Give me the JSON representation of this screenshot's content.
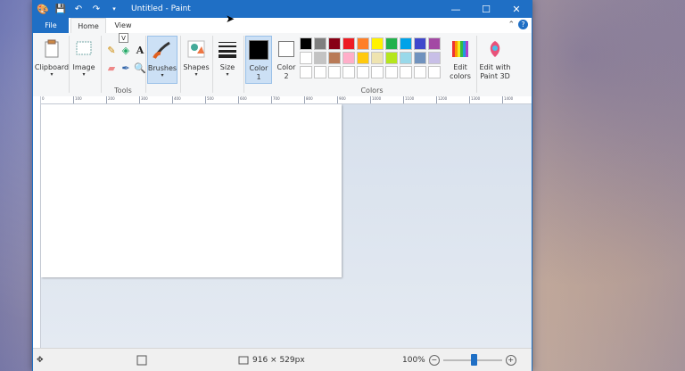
{
  "window": {
    "title": "Untitled - Paint"
  },
  "titlebar_buttons": {
    "minimize": "—",
    "maximize": "☐",
    "close": "✕"
  },
  "tabs": {
    "file": "File",
    "home": "Home",
    "view": "View"
  },
  "keytip": "V",
  "ribbon": {
    "clipboard": {
      "label": "Clipboard"
    },
    "image": {
      "label": "Image"
    },
    "tools_group": {
      "label": "Tools"
    },
    "brushes": {
      "label": "Brushes"
    },
    "shapes": {
      "label": "Shapes"
    },
    "size": {
      "label": "Size"
    },
    "color1": {
      "label": "Color",
      "sub": "1"
    },
    "color2": {
      "label": "Color",
      "sub": "2"
    },
    "colors_group": {
      "label": "Colors"
    },
    "edit_colors": {
      "label": "Edit",
      "sub": "colors"
    },
    "paint3d": {
      "label": "Edit with",
      "sub": "Paint 3D"
    },
    "text_tool_glyph": "A"
  },
  "palette": [
    "#000000",
    "#7f7f7f",
    "#880015",
    "#ed1c24",
    "#ff7f27",
    "#fff200",
    "#22b14c",
    "#00a2e8",
    "#3f48cc",
    "#a349a4",
    "#ffffff",
    "#c3c3c3",
    "#b97a57",
    "#ffaec9",
    "#ffc90e",
    "#efe4b0",
    "#b5e61d",
    "#99d9ea",
    "#7092be",
    "#c8bfe7",
    "#ffffff",
    "#ffffff",
    "#ffffff",
    "#ffffff",
    "#ffffff",
    "#ffffff",
    "#ffffff",
    "#ffffff",
    "#ffffff",
    "#ffffff"
  ],
  "ruler_ticks": [
    "0",
    "100",
    "200",
    "300",
    "400",
    "500",
    "600",
    "700",
    "800",
    "900",
    "1000",
    "1100",
    "1200",
    "1300",
    "1400"
  ],
  "status": {
    "canvas_size": "916 × 529px",
    "zoom": "100%",
    "zoom_minus": "−",
    "zoom_plus": "+"
  }
}
